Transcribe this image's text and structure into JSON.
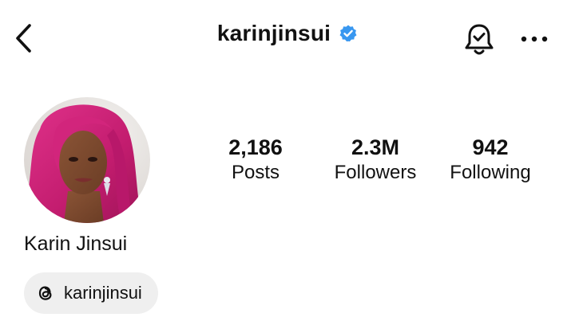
{
  "header": {
    "username": "karinjinsui",
    "verified_color": "#3897f0",
    "back_icon": "chevron-left-icon",
    "bell_icon": "bell-check-icon",
    "more_icon": "more-horizontal-icon"
  },
  "profile": {
    "display_name": "Karin Jinsui",
    "avatar_accent": "#d6247a",
    "stats": [
      {
        "value": "2,186",
        "label": "Posts"
      },
      {
        "value": "2.3M",
        "label": "Followers"
      },
      {
        "value": "942",
        "label": "Following"
      }
    ],
    "threads_chip": {
      "icon": "threads-icon",
      "label": "karinjinsui"
    }
  }
}
